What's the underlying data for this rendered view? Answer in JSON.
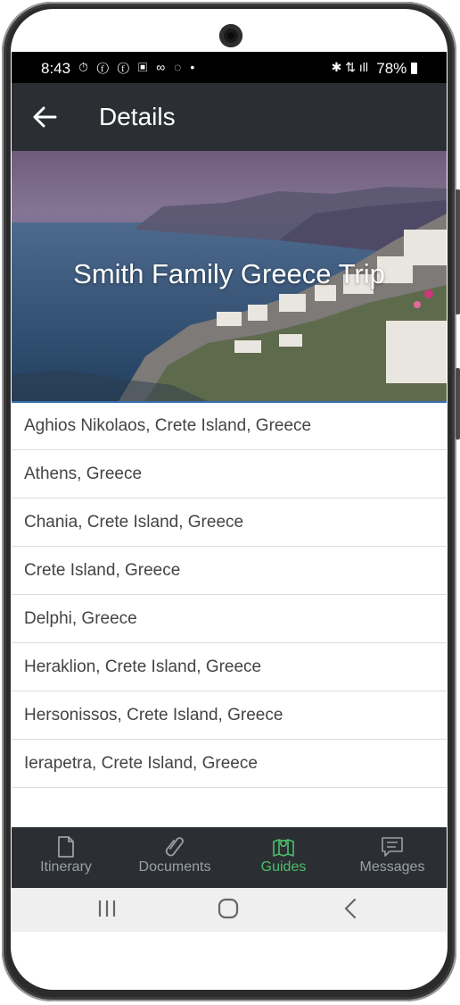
{
  "status_bar": {
    "time": "8:43",
    "battery": "78%"
  },
  "app_bar": {
    "title": "Details"
  },
  "hero": {
    "title": "Smith Family Greece Trip"
  },
  "destinations": [
    "Aghios Nikolaos, Crete Island, Greece",
    "Athens, Greece",
    "Chania, Crete Island, Greece",
    "Crete Island, Greece",
    "Delphi, Greece",
    "Heraklion, Crete Island, Greece",
    "Hersonissos, Crete Island, Greece",
    "Ierapetra, Crete Island, Greece"
  ],
  "tabs": [
    {
      "label": "Itinerary",
      "icon": "document-icon"
    },
    {
      "label": "Documents",
      "icon": "paperclip-icon"
    },
    {
      "label": "Guides",
      "icon": "map-pin-icon",
      "active": true
    },
    {
      "label": "Messages",
      "icon": "chat-icon"
    }
  ],
  "colors": {
    "app_bar": "#2b2f33",
    "active_tab": "#4cbf6a",
    "inactive_tab": "#9aa0a6"
  }
}
